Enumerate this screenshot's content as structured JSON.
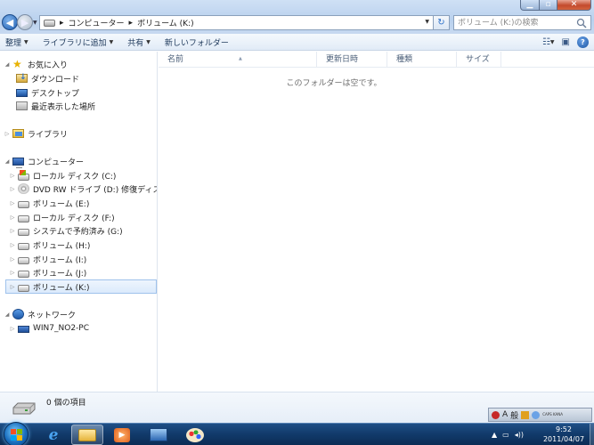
{
  "address": {
    "segments": [
      "コンピューター",
      "ボリューム (K:)"
    ],
    "separator": "▸"
  },
  "search": {
    "placeholder": "ボリューム (K:)の検索"
  },
  "toolbar": {
    "organize": "整理",
    "add_to_library": "ライブラリに追加",
    "share": "共有",
    "new_folder": "新しいフォルダー"
  },
  "nav": {
    "favorites": {
      "label": "お気に入り",
      "items": [
        "ダウンロード",
        "デスクトップ",
        "最近表示した場所"
      ]
    },
    "libraries": {
      "label": "ライブラリ"
    },
    "computer": {
      "label": "コンピューター",
      "drives": [
        "ローカル ディスク (C:)",
        "DVD RW ドライブ (D:) 修復ディスク W",
        "ボリューム (E:)",
        "ローカル ディスク (F:)",
        "システムで予約済み (G:)",
        "ボリューム (H:)",
        "ボリューム (I:)",
        "ボリューム (J:)",
        "ボリューム (K:)"
      ],
      "selected": "ボリューム (K:)"
    },
    "network": {
      "label": "ネットワーク",
      "items": [
        "WIN7_NO2-PC"
      ]
    }
  },
  "columns": [
    "名前",
    "更新日時",
    "種類",
    "サイズ"
  ],
  "empty_message": "このフォルダーは空です。",
  "details": {
    "count": "0 個の項目"
  },
  "ime": {
    "mode": "A",
    "kana": "般",
    "small": "CAPS KANA"
  },
  "clock": {
    "time": "9:52",
    "date": "2011/04/07"
  },
  "colors": {
    "accent": "#1e395b",
    "selection": "#dbeafc",
    "taskbar": "#113a6a"
  }
}
